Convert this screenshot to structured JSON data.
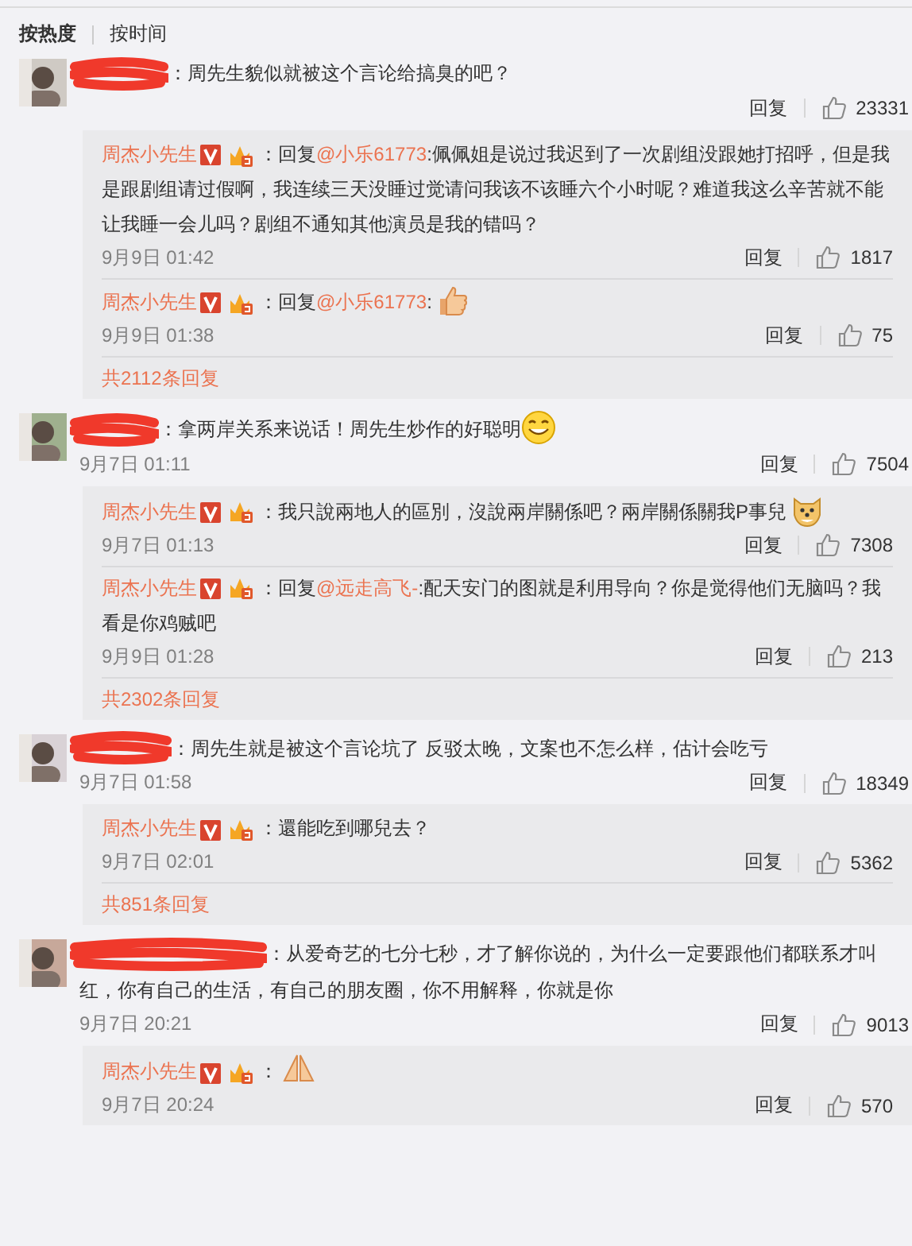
{
  "sort_tabs": [
    {
      "label": "按热度",
      "selected": true
    },
    {
      "label": "按时间",
      "selected": false
    }
  ],
  "comments": [
    {
      "text": [
        {
          "kind": "text",
          "value": "：周先生貌似就被这个言论给搞臭的吧？"
        }
      ],
      "reply_label": "回复",
      "likes": "23331",
      "replies": [
        {
          "name": "周杰小先生",
          "text": [
            {
              "kind": "text",
              "value": "：回复"
            },
            {
              "kind": "mention",
              "value": "@小乐61773"
            },
            {
              "kind": "text",
              "value": ":佩佩姐是说过我迟到了一次剧组没跟她打招呼，但是我是跟剧组请过假啊，我连续三天没睡过觉请问我该不该睡六个小时呢？难道我这么辛苦就不能让我睡一会儿吗？剧组不通知其他演员是我的错吗？"
            }
          ],
          "time": "9月9日 01:42",
          "reply_label": "回复",
          "likes": "1817"
        },
        {
          "name": "周杰小先生",
          "text": [
            {
              "kind": "text",
              "value": "：回复"
            },
            {
              "kind": "mention",
              "value": "@小乐61773"
            },
            {
              "kind": "text",
              "value": ":"
            },
            {
              "kind": "thumb"
            }
          ],
          "time": "9月9日 01:38",
          "reply_label": "回复",
          "likes": "75"
        }
      ],
      "more": "共2112条回复"
    },
    {
      "text": [
        {
          "kind": "text",
          "value": "：拿两岸关系来说话！周先生炒作的好聪明"
        },
        {
          "kind": "grin"
        }
      ],
      "time": "9月7日 01:11",
      "reply_label": "回复",
      "likes": "7504",
      "replies": [
        {
          "name": "周杰小先生",
          "text": [
            {
              "kind": "text",
              "value": "：我只說兩地人的區別，沒說兩岸關係吧？兩岸關係關我P事兒"
            },
            {
              "kind": "doge"
            }
          ],
          "time": "9月7日 01:13",
          "reply_label": "回复",
          "likes": "7308"
        },
        {
          "name": "周杰小先生",
          "text": [
            {
              "kind": "text",
              "value": "：回复"
            },
            {
              "kind": "mention",
              "value": "@远走高飞-"
            },
            {
              "kind": "text",
              "value": ":配天安门的图就是利用导向？你是觉得他们无脑吗？我看是你鸡贼吧"
            }
          ],
          "time": "9月9日 01:28",
          "reply_label": "回复",
          "likes": "213"
        }
      ],
      "more": "共2302条回复"
    },
    {
      "text": [
        {
          "kind": "text",
          "value": "：周先生就是被这个言论坑了 反驳太晚，文案也不怎么样，估计会吃亏"
        }
      ],
      "time": "9月7日 01:58",
      "reply_label": "回复",
      "likes": "18349",
      "replies": [
        {
          "name": "周杰小先生",
          "text": [
            {
              "kind": "text",
              "value": "：還能吃到哪兒去？"
            }
          ],
          "time": "9月7日 02:01",
          "reply_label": "回复",
          "likes": "5362"
        }
      ],
      "more": "共851条回复"
    },
    {
      "text": [
        {
          "kind": "text",
          "value": "：从爱奇艺的七分七秒，才了解你说的，为什么一定要跟他们都联系才叫红，你有自己的生活，有自己的朋友圈，你不用解释，你就是你"
        }
      ],
      "time": "9月7日 20:21",
      "reply_label": "回复",
      "likes": "9013",
      "replies": [
        {
          "name": "周杰小先生",
          "text": [
            {
              "kind": "text",
              "value": "："
            },
            {
              "kind": "palms"
            }
          ],
          "time": "9月7日 20:24",
          "reply_label": "回复",
          "likes": "570"
        }
      ]
    }
  ]
}
